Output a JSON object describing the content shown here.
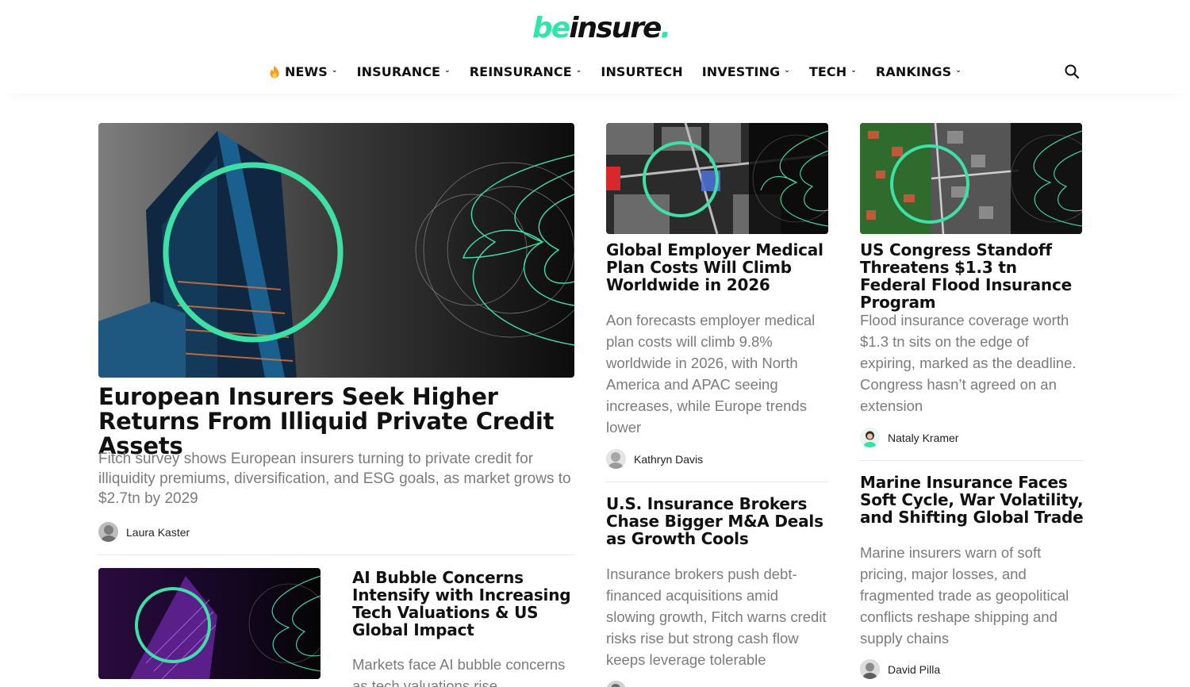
{
  "brand": {
    "logo_be": "be",
    "logo_rest": "insure",
    "logo_dot": ".",
    "accent": "#2ee6a8"
  },
  "nav": {
    "items": [
      {
        "label": "NEWS",
        "has_dropdown": true,
        "icon": "fire-icon"
      },
      {
        "label": "INSURANCE",
        "has_dropdown": true
      },
      {
        "label": "REINSURANCE",
        "has_dropdown": true
      },
      {
        "label": "INSURTECH",
        "has_dropdown": false
      },
      {
        "label": "INVESTING",
        "has_dropdown": true
      },
      {
        "label": "TECH",
        "has_dropdown": true
      },
      {
        "label": "RANKINGS",
        "has_dropdown": true
      }
    ],
    "chevron": "⌄",
    "search_icon": "search-icon"
  },
  "articles": {
    "featured": {
      "title": "European Insurers Seek Higher Returns From Illiquid Private Credit Assets",
      "excerpt": "Fitch survey shows European insurers turning to private credit for illiquidity premiums, diversification, and ESG goals, as market grows to $2.7tn by 2029",
      "author": "Laura Kaster"
    },
    "medical": {
      "title": "Global Employer Medical Plan Costs Will Climb Worldwide in 2026",
      "excerpt": "Aon forecasts employer medical plan costs will climb 9.8% worldwide in 2026, with North America and APAC seeing increases, while Europe trends lower",
      "author": "Kathryn Davis"
    },
    "flood": {
      "title": "US Congress Standoff Threatens $1.3 tn Federal Flood Insurance Program",
      "excerpt": "Flood insurance coverage worth $1.3 tn sits on the edge of expiring, marked as the deadline. Congress hasn’t agreed on an extension",
      "author": "Nataly Kramer"
    },
    "brokers": {
      "title": "U.S. Insurance Brokers Chase Bigger M&A Deals as Growth Cools",
      "excerpt": "Insurance brokers push debt-financed acquisitions amid slowing growth, Fitch warns credit risks rise but strong cash flow keeps leverage tolerable"
    },
    "marine": {
      "title": "Marine Insurance Faces Soft Cycle, War Volatility, and Shifting Global Trade",
      "excerpt": "Marine insurers warn of soft pricing, major losses, and fragmented trade as geopolitical conflicts reshape shipping and supply chains",
      "author": "David Pilla"
    },
    "ai": {
      "title": "AI Bubble Concerns Intensify with Increasing Tech Valuations & US Global Impact",
      "excerpt": "Markets face AI bubble concerns as tech valuations rise"
    }
  }
}
